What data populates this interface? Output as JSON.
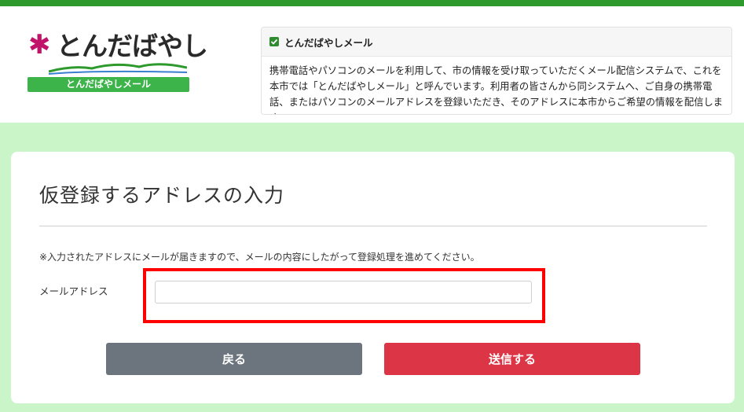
{
  "header": {
    "logo": {
      "flower_glyph": "✱",
      "title": "とんだばやし",
      "subtitle": "とんだばやしメール"
    },
    "info": {
      "title": "とんだばやしメール",
      "body": "携帯電話やパソコンのメールを利用して、市の情報を受け取っていただくメール配信システムで、これを本市では「とんだばやしメール」と呼んでいます。利用者の皆さんから同システムへ、ご自身の携帯電話、またはパソコンのメールアドレスを登録いただき、そのアドレスに本市からご希望の情報を配信します。"
    }
  },
  "form": {
    "title": "仮登録するアドレスの入力",
    "notice": "※入力されたアドレスにメールが届きますので、メールの内容にしたがって登録処理を進めてください。",
    "email_label": "メールアドレス",
    "email_value": "",
    "email_placeholder": "",
    "back_label": "戻る",
    "send_label": "送信する"
  },
  "colors": {
    "top_bar": "#2e9a2e",
    "page_background": "#c9f5c9",
    "back_button": "#6c757d",
    "send_button": "#dc3545",
    "highlight_box": "#ff0000"
  }
}
